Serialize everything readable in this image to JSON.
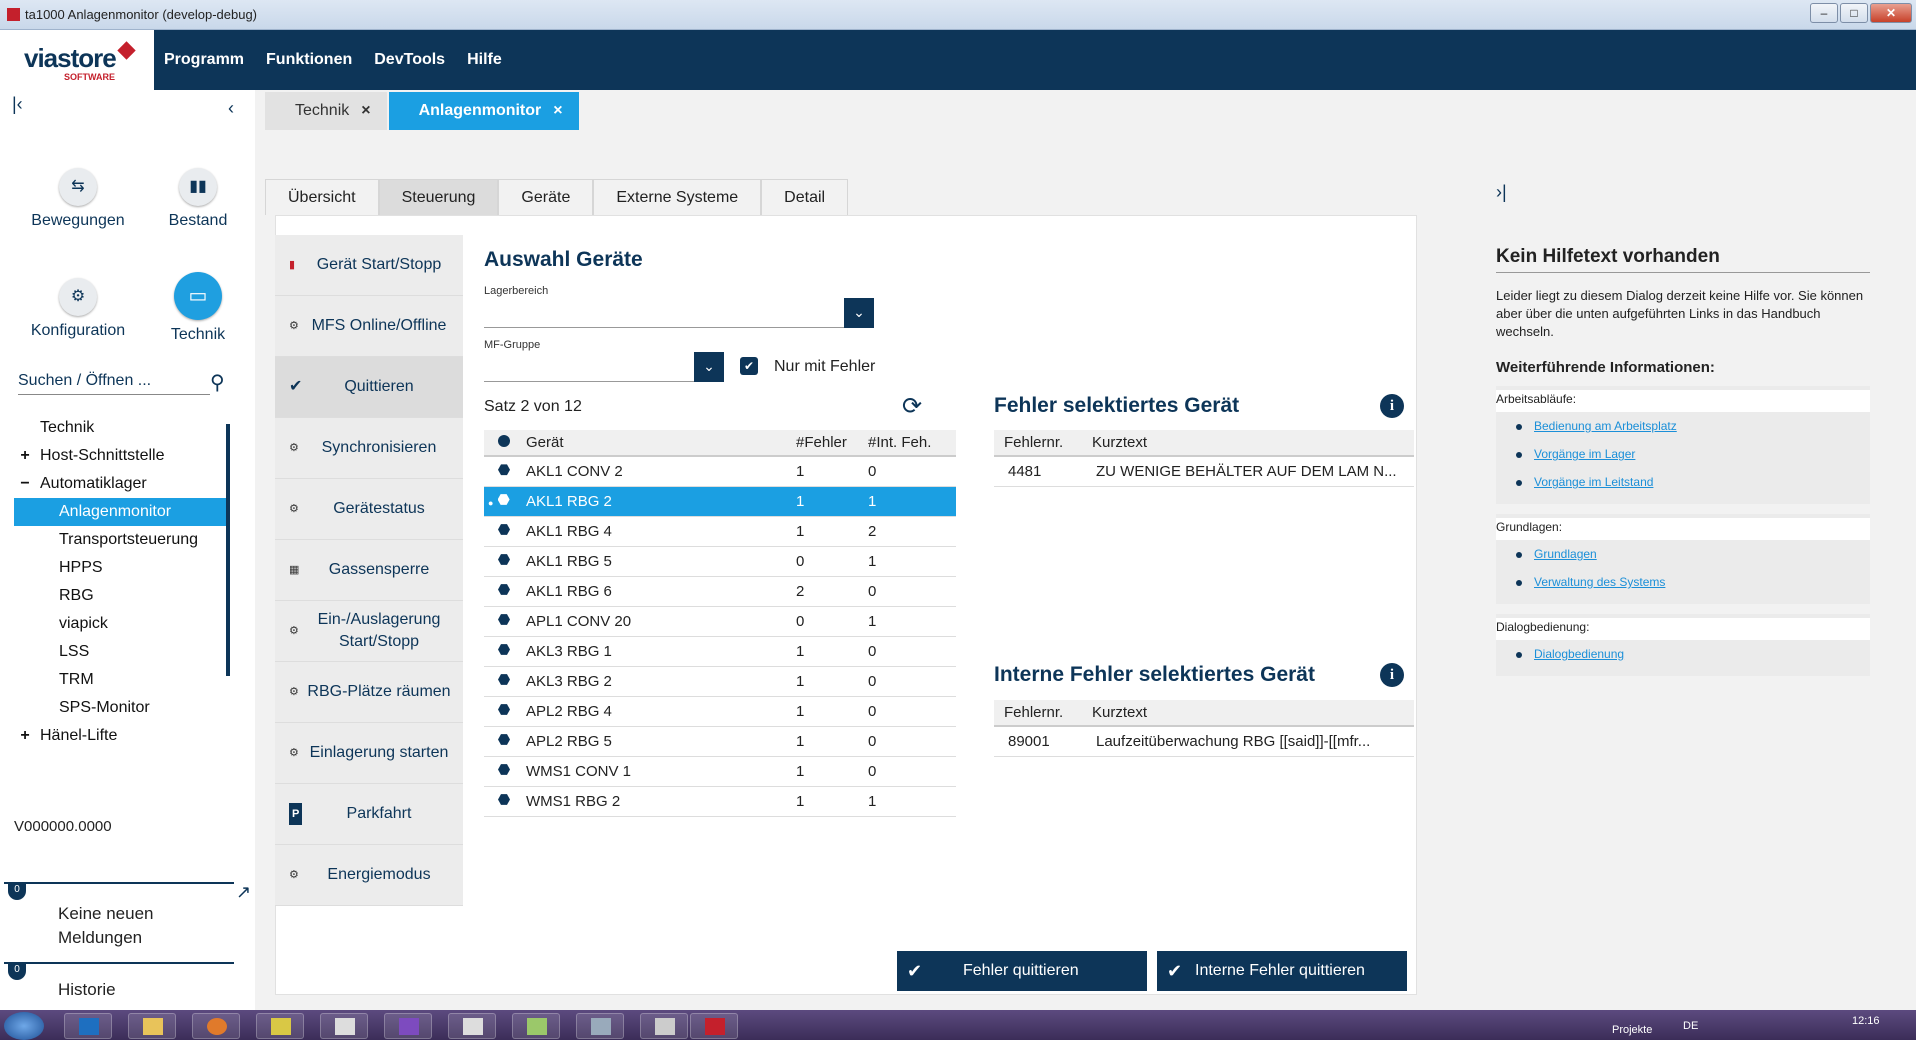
{
  "window": {
    "title": "ta1000 Anlagenmonitor (develop-debug)"
  },
  "brand": {
    "name": "viastore",
    "sub": "SOFTWARE"
  },
  "menu": [
    "Programm",
    "Funktionen",
    "DevTools",
    "Hilfe"
  ],
  "doc_tabs": [
    {
      "label": "Technik",
      "close": "×"
    },
    {
      "label": "Anlagenmonitor",
      "close": "×"
    }
  ],
  "tiles": {
    "bewegungen": "Bewegungen",
    "bestand": "Bestand",
    "konfiguration": "Konfiguration",
    "technik": "Technik"
  },
  "search": {
    "label": "Suchen / Öffnen ..."
  },
  "tree": [
    {
      "label": "Technik",
      "pm": ""
    },
    {
      "label": "Host-Schnittstelle",
      "pm": "+"
    },
    {
      "label": "Automatiklager",
      "pm": "−"
    },
    {
      "label": "Anlagenmonitor",
      "pm": ""
    },
    {
      "label": "Transportsteuerung",
      "pm": ""
    },
    {
      "label": "HPPS",
      "pm": ""
    },
    {
      "label": "RBG",
      "pm": ""
    },
    {
      "label": "viapick",
      "pm": ""
    },
    {
      "label": "LSS",
      "pm": ""
    },
    {
      "label": "TRM",
      "pm": ""
    },
    {
      "label": "SPS-Monitor",
      "pm": ""
    },
    {
      "label": "Hänel-Lifte",
      "pm": "+"
    }
  ],
  "version": "V000000.0000",
  "messages": {
    "count1": "0",
    "text1": "Keine neuen Meldungen",
    "count2": "0",
    "text2": "Historie"
  },
  "hnav": [
    "Übersicht",
    "Steuerung",
    "Geräte",
    "Externe Systeme",
    "Detail"
  ],
  "leftnav": [
    "Gerät Start/Stopp",
    "MFS Online/Offline",
    "Quittieren",
    "Synchronisieren",
    "Gerätestatus",
    "Gassensperre",
    "Ein-/Auslagerung Start/Stopp",
    "RBG-Plätze räumen",
    "Einlagerung starten",
    "Parkfahrt",
    "Energiemodus"
  ],
  "auswahl": {
    "title": "Auswahl Geräte",
    "lagerbereich_label": "Lagerbereich",
    "lagerbereich_value": "",
    "mfgruppe_label": "MF-Gruppe",
    "mfgruppe_value": "",
    "checkbox_label": "Nur mit Fehler",
    "satz": "Satz 2 von 12"
  },
  "geraete": {
    "columns": [
      "Gerät",
      "#Fehler",
      "#Int. Feh."
    ],
    "rows": [
      [
        "AKL1 CONV 2",
        "1",
        "0"
      ],
      [
        "AKL1 RBG 2",
        "1",
        "1"
      ],
      [
        "AKL1 RBG 4",
        "1",
        "2"
      ],
      [
        "AKL1 RBG 5",
        "0",
        "1"
      ],
      [
        "AKL1 RBG 6",
        "2",
        "0"
      ],
      [
        "APL1 CONV 20",
        "0",
        "1"
      ],
      [
        "AKL3 RBG 1",
        "1",
        "0"
      ],
      [
        "AKL3 RBG 2",
        "1",
        "0"
      ],
      [
        "APL2 RBG 4",
        "1",
        "0"
      ],
      [
        "APL2 RBG 5",
        "1",
        "0"
      ],
      [
        "WMS1 CONV 1",
        "1",
        "0"
      ],
      [
        "WMS1 RBG 2",
        "1",
        "1"
      ]
    ]
  },
  "fehler": {
    "title": "Fehler selektiertes Gerät",
    "columns": [
      "Fehlernr.",
      "Kurztext"
    ],
    "row": [
      "4481",
      "ZU WENIGE BEHÄLTER AUF DEM LAM N..."
    ]
  },
  "intfehler": {
    "title": "Interne Fehler selektiertes Gerät",
    "columns": [
      "Fehlernr.",
      "Kurztext"
    ],
    "row": [
      "89001",
      "Laufzeitüberwachung RBG [[said]]-[[mfr..."
    ]
  },
  "buttons": {
    "fehler": "Fehler quittieren",
    "intern": "Interne Fehler quittieren"
  },
  "help": {
    "title": "Kein Hilfetext vorhanden",
    "text": "Leider liegt zu diesem Dialog derzeit keine Hilfe vor. Sie können aber über die unten aufgeführten Links in das Handbuch wechseln.",
    "more": "Weiterführende Informationen:",
    "groups": [
      {
        "caption": "Arbeitsabläufe:",
        "links": [
          "Bedienung am Arbeitsplatz",
          "Vorgänge im Lager",
          "Vorgänge im Leitstand"
        ]
      },
      {
        "caption": "Grundlagen:",
        "links": [
          "Grundlagen",
          "Verwaltung des Systems"
        ]
      },
      {
        "caption": "Dialogbedienung:",
        "links": [
          "Dialogbedienung"
        ]
      }
    ]
  },
  "taskbar": {
    "lang": "DE",
    "projekte": "Projekte",
    "time": "12:16"
  }
}
